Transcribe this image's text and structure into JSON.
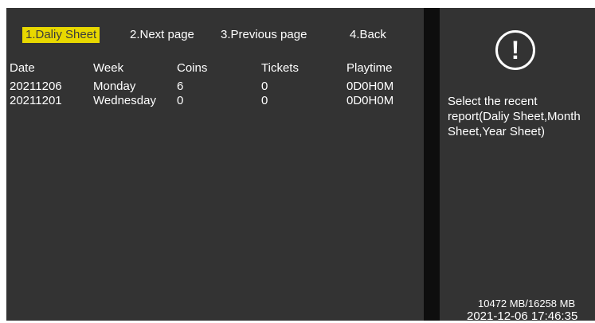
{
  "menu": {
    "items": [
      {
        "label": "1.Daliy Sheet",
        "active": true
      },
      {
        "label": "2.Next page",
        "active": false
      },
      {
        "label": "3.Previous page",
        "active": false
      },
      {
        "label": "4.Back",
        "active": false
      }
    ]
  },
  "table": {
    "headers": [
      "Date",
      "Week",
      "Coins",
      "Tickets",
      "Playtime"
    ],
    "rows": [
      [
        "20211206",
        "Monday",
        "6",
        "0",
        "0D0H0M"
      ],
      [
        "20211201",
        "Wednesday",
        "0",
        "0",
        "0D0H0M"
      ]
    ]
  },
  "side": {
    "alert_icon": "exclamation-circle-icon",
    "alert_glyph": "!",
    "help_text": "Select the recent report(Daliy Sheet,Month Sheet,Year Sheet)",
    "storage": "10472 MB/16258 MB",
    "clock": "2021-12-06 17:46:35"
  },
  "colors": {
    "background": "#333333",
    "divider": "#0e0e0e",
    "highlight": "#e8d800",
    "text": "#ffffff"
  }
}
